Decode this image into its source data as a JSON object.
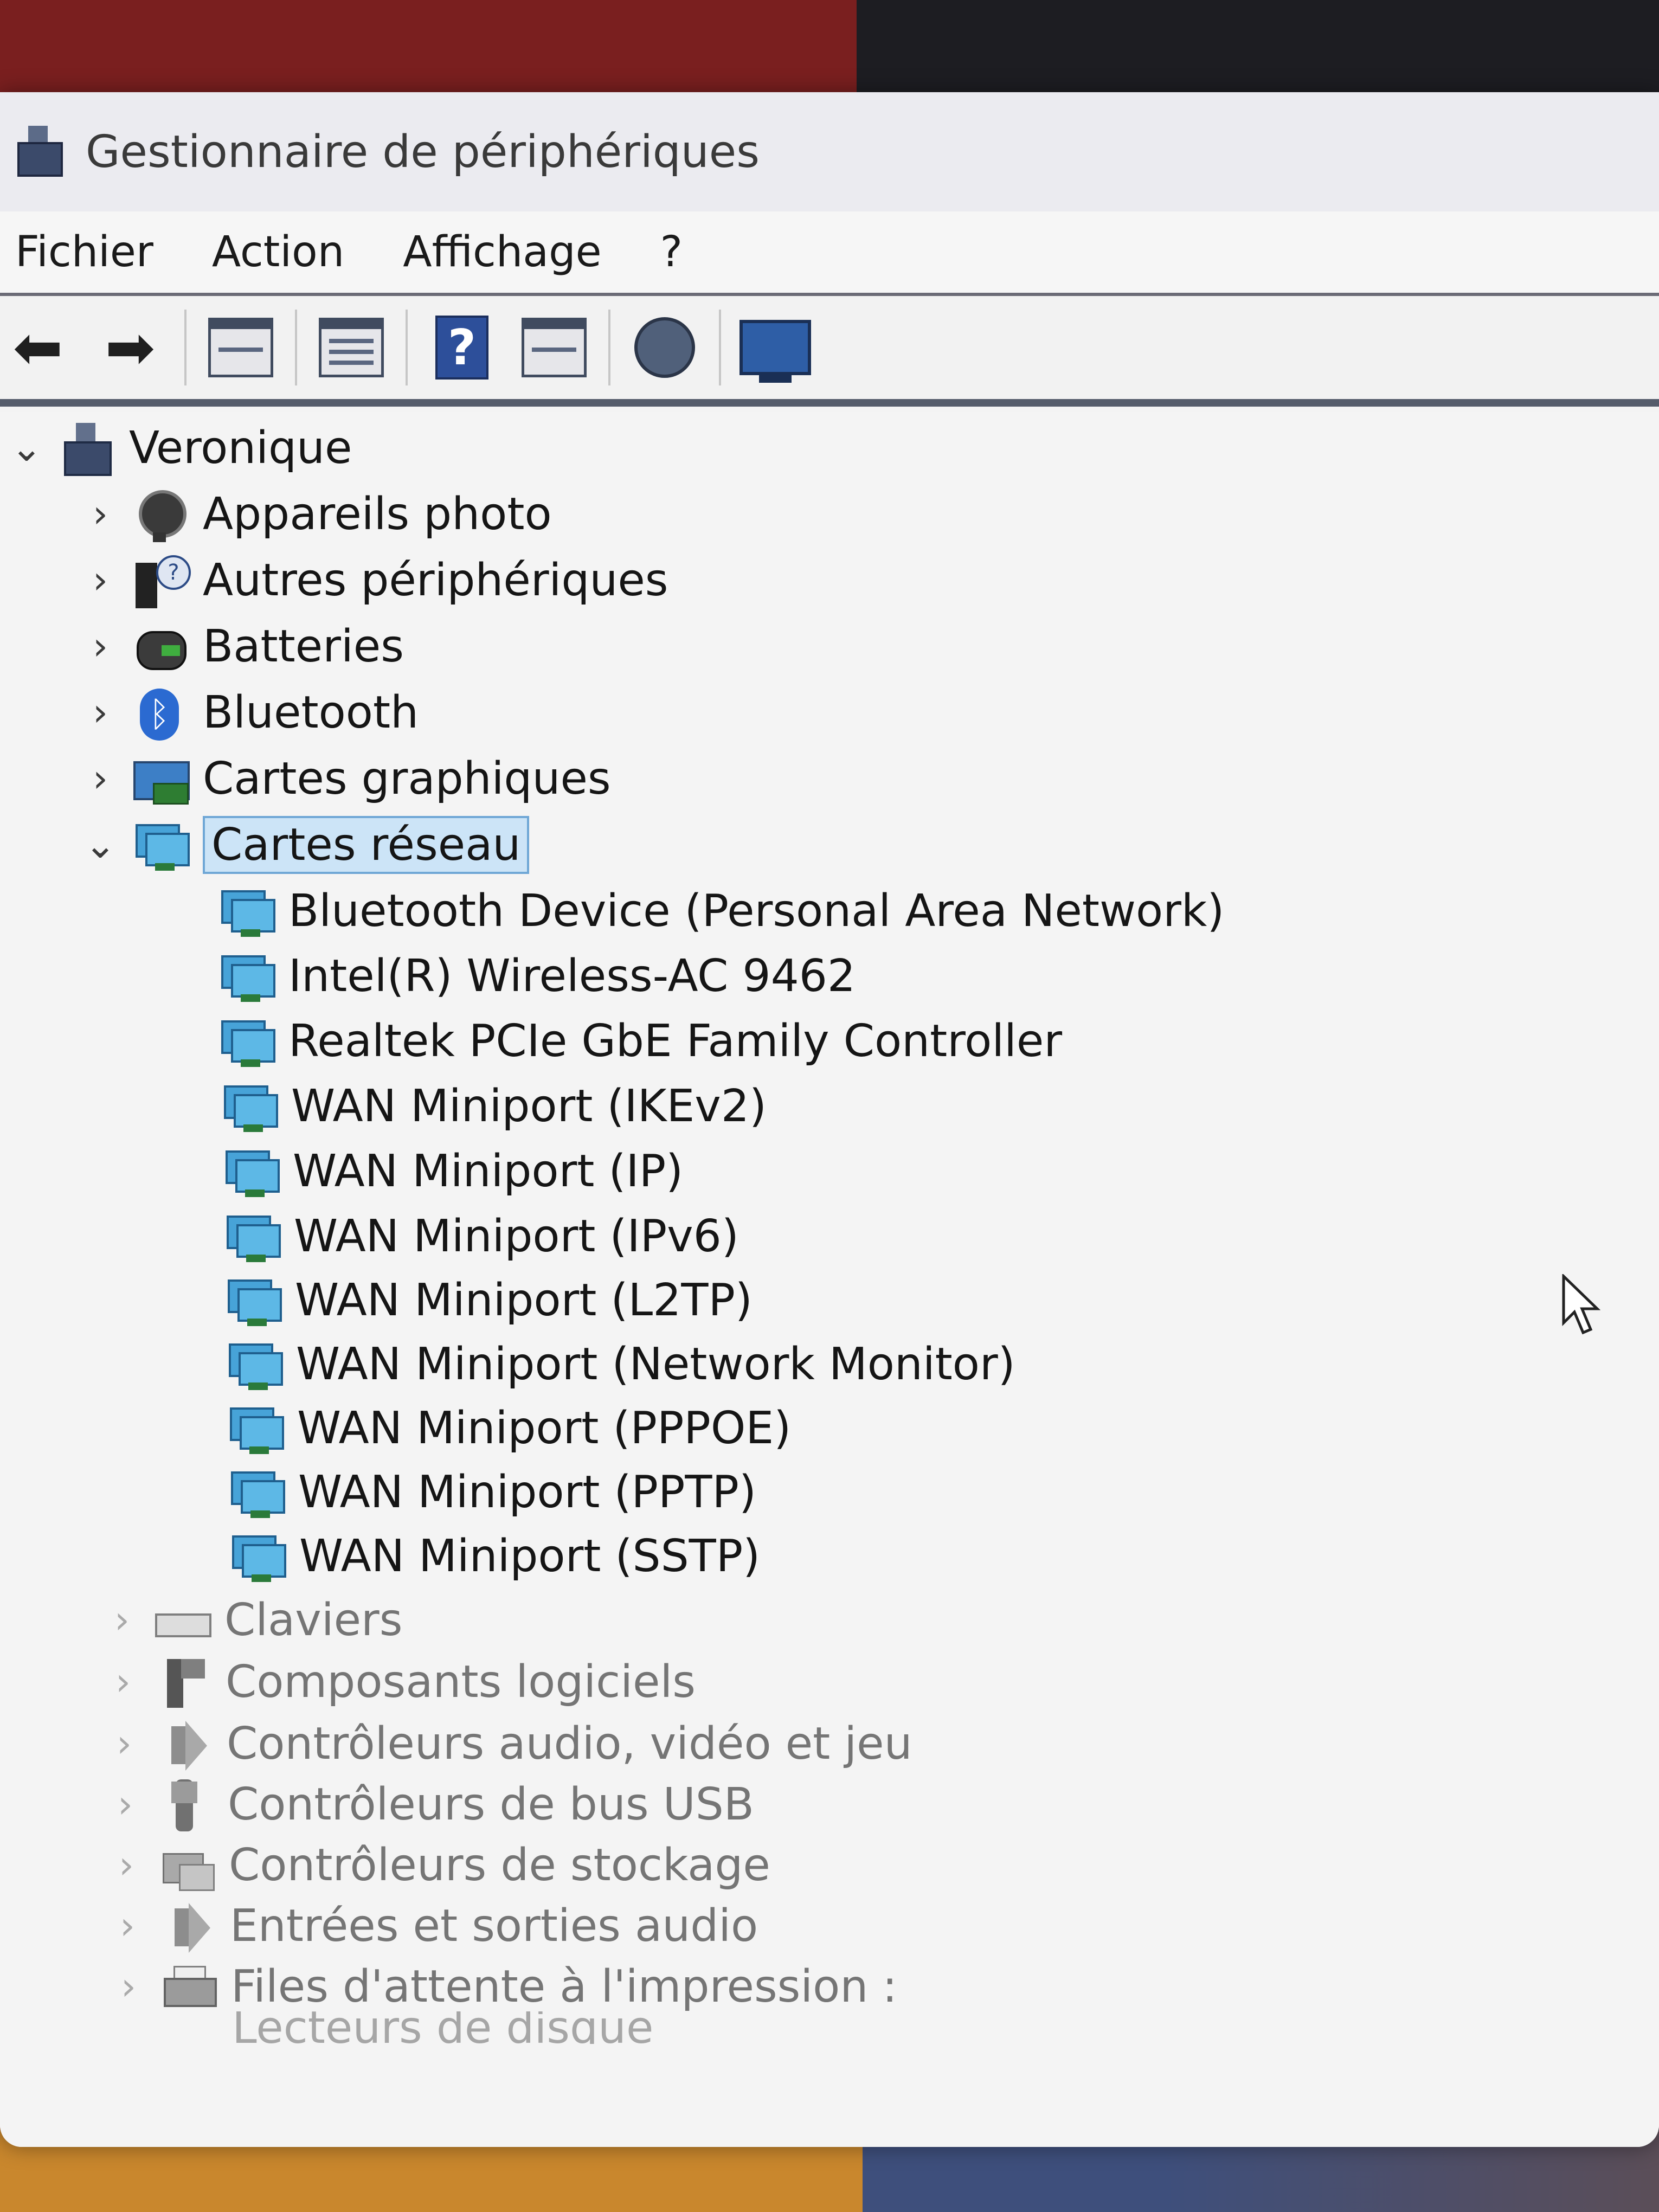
{
  "window": {
    "title": "Gestionnaire de périphériques"
  },
  "menubar": {
    "items": [
      "Fichier",
      "Action",
      "Affichage",
      "?"
    ]
  },
  "toolbar": {
    "buttons": [
      "back-arrow-icon",
      "forward-arrow-icon",
      "show-hide-console-tree-icon",
      "properties-icon",
      "help-icon",
      "show-action-pane-icon",
      "update-driver-icon",
      "scan-hardware-icon"
    ]
  },
  "tree": {
    "root": "Veronique",
    "categories": [
      {
        "label": "Appareils photo",
        "expanded": false
      },
      {
        "label": "Autres périphériques",
        "expanded": false
      },
      {
        "label": "Batteries",
        "expanded": false
      },
      {
        "label": "Bluetooth",
        "expanded": false
      },
      {
        "label": "Cartes graphiques",
        "expanded": false
      },
      {
        "label": "Cartes réseau",
        "expanded": true,
        "selected": true
      }
    ],
    "network_adapters": [
      "Bluetooth Device (Personal Area Network)",
      "Intel(R) Wireless-AC 9462",
      "Realtek PCIe GbE Family Controller",
      "WAN Miniport (IKEv2)",
      "WAN Miniport (IP)",
      "WAN Miniport (IPv6)",
      "WAN Miniport (L2TP)",
      "WAN Miniport (Network Monitor)",
      "WAN Miniport (PPPOE)",
      "WAN Miniport (PPTP)",
      "WAN Miniport (SSTP)"
    ],
    "more_categories": [
      "Claviers",
      "Composants logiciels",
      "Contrôleurs audio, vidéo et jeu",
      "Contrôleurs de bus USB",
      "Contrôleurs de stockage",
      "Entrées et sorties audio",
      "Files d'attente à l'impression :",
      "Lecteurs de disque"
    ]
  },
  "glyphs": {
    "collapsed": "›",
    "expanded": "⌄",
    "back": "⬅",
    "forward": "➡",
    "help": "?"
  }
}
